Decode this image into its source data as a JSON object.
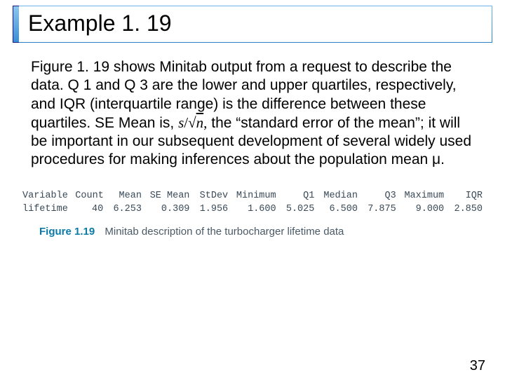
{
  "title": "Example 1. 19",
  "paragraph": {
    "part1": "Figure 1. 19 shows Minitab output from a request to describe the data. Q 1 and Q 3 are the lower and upper quartiles, respectively, and IQR (interquartile range) is the difference between these quartiles. SE Mean is, ",
    "formula_s": "s",
    "formula_n": "n",
    "part2": " the “standard error of the mean”; it will be important in our subsequent development of several widely used procedures for making inferences about the population mean μ."
  },
  "chart_data": {
    "type": "table",
    "headers": [
      "Variable",
      "Count",
      "Mean",
      "SE Mean",
      "StDev",
      "Minimum",
      "Q1",
      "Median",
      "Q3",
      "Maximum",
      "IQR"
    ],
    "rows": [
      [
        "lifetime",
        "40",
        "6.253",
        "0.309",
        "1.956",
        "1.600",
        "5.025",
        "6.500",
        "7.875",
        "9.000",
        "2.850"
      ]
    ]
  },
  "caption": {
    "label": "Figure 1.19",
    "text": "Minitab description of the turbocharger lifetime data"
  },
  "page_number": "37"
}
